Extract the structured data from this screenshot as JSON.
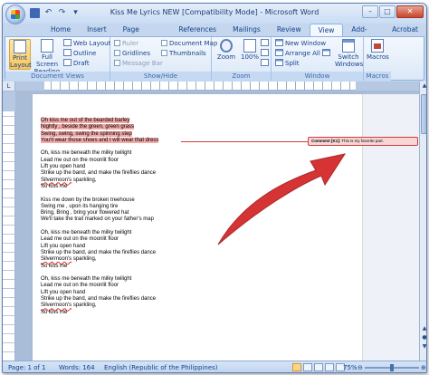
{
  "window": {
    "title": "Kiss Me Lyrics NEW [Compatibility Mode] - Microsoft Word",
    "controls": {
      "minimize": "–",
      "maximize": "□",
      "close": "✕"
    }
  },
  "quick_access": {
    "undo_glyph": "↶",
    "redo_glyph": "↷",
    "more_glyph": "▾"
  },
  "tabs": [
    "Home",
    "Insert",
    "Page Layout",
    "References",
    "Mailings",
    "Review",
    "View",
    "Add-Ins",
    "Acrobat"
  ],
  "active_tab": "View",
  "ribbon": {
    "document_views": {
      "label": "Document Views",
      "print_layout": "Print Layout",
      "full_screen_reading": "Full Screen Reading",
      "web_layout": "Web Layout",
      "outline": "Outline",
      "draft": "Draft"
    },
    "show_hide": {
      "label": "Show/Hide",
      "ruler": "Ruler",
      "gridlines": "Gridlines",
      "message_bar": "Message Bar",
      "document_map": "Document Map",
      "thumbnails": "Thumbnails"
    },
    "zoom": {
      "label": "Zoom",
      "zoom": "Zoom",
      "hundred": "100%"
    },
    "window": {
      "label": "Window",
      "new_window": "New Window",
      "arrange_all": "Arrange All",
      "split": "Split",
      "switch_windows": "Switch Windows"
    },
    "macros": {
      "label": "Macros",
      "macros": "Macros"
    }
  },
  "ruler": {
    "corner_glyph": "L"
  },
  "document": {
    "stanzas": [
      [
        "Oh kiss me out of the bearded barley",
        "Nightly , beside the green, green grass",
        "Swing, swing, swing the spinning step",
        "You'll wear those shoes and I will wear that dress"
      ],
      [
        "Oh, kiss me beneath the milky twilight",
        "Lead me out on the moonlit floor",
        "Lift you open hand",
        "Strike up the band, and make the fireflies dance",
        "Silvermoon's sparkling,",
        "So kiss me"
      ],
      [
        "Kiss me down by the broken treehouse",
        "Swing me , upon its hanging tire",
        "Bring, Bring , bring your flowered hat",
        "We'll take the trail marked on your father's map"
      ],
      [
        "Oh, kiss me beneath the milky twilight",
        "Lead me out on the moonlit floor",
        "Lift you open hand",
        "Strike up the band, and make the fireflies dance",
        "Silvermoon's sparkling,",
        "So kiss me"
      ],
      [
        "Oh, kiss me beneath the milky twilight",
        "Lead me out on the moonlit floor",
        "Lift you open hand",
        "Strike up the band, and make the fireflies dance",
        "Silvermoon's sparkling,",
        "So kiss me"
      ]
    ],
    "highlighted_stanza": 0,
    "misspelled_word": "Silvermoon's",
    "comment": {
      "tag": "Comment [K1]:",
      "text": "This is my favorite part."
    }
  },
  "status_bar": {
    "page": "Page: 1 of 1",
    "words": "Words: 164",
    "language": "English (Republic of the Philippines)",
    "zoom": "75%",
    "zoom_out": "⊖",
    "zoom_in": "⊕"
  },
  "colors": {
    "highlight": "#f2aaa8",
    "comment_border": "#d23b3b",
    "arrow": "#d42a2a"
  }
}
